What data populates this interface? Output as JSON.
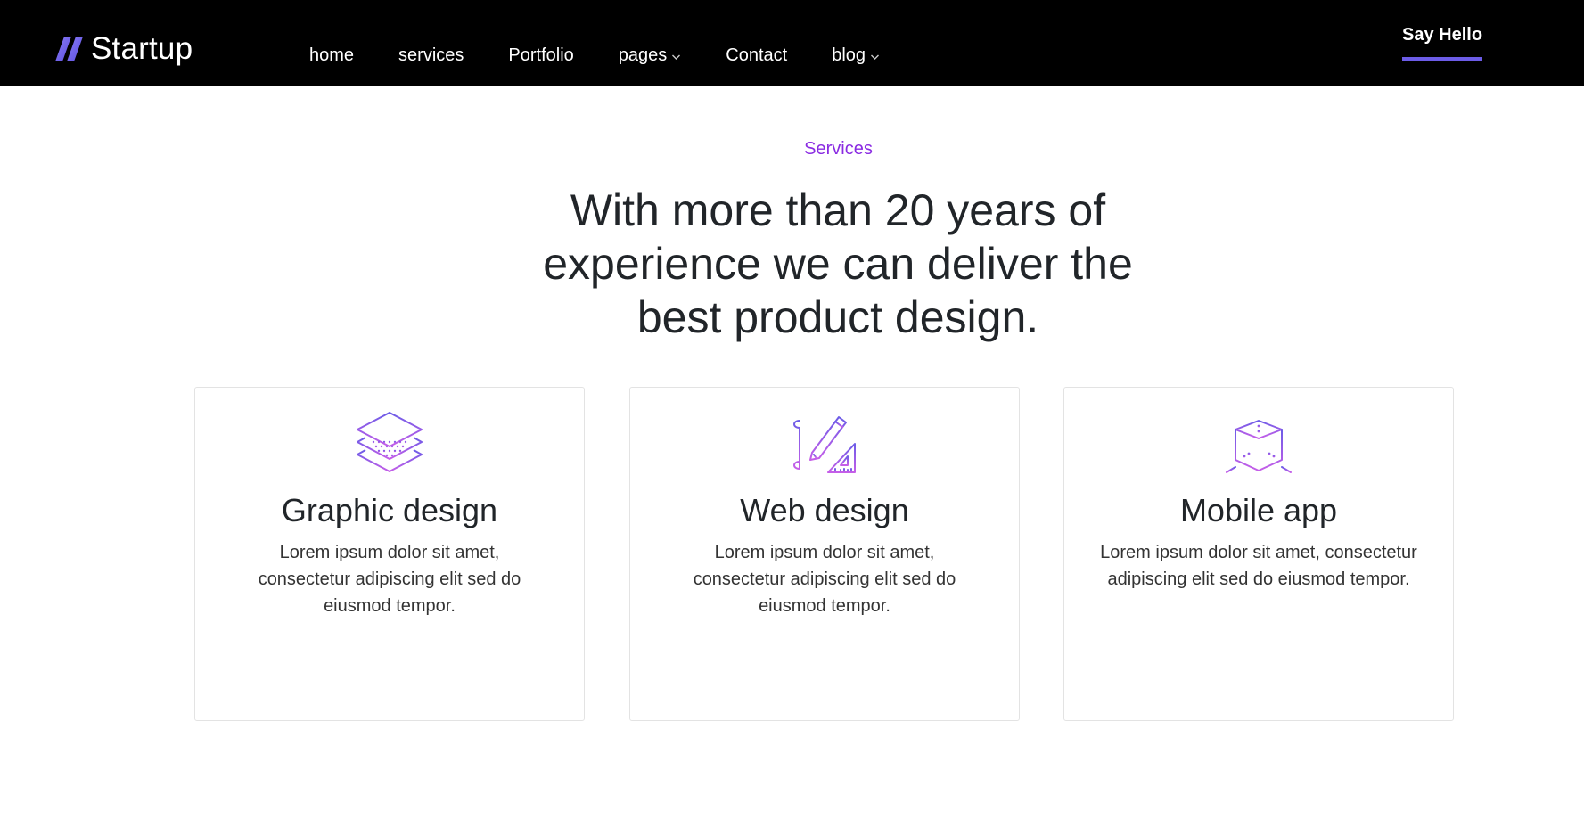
{
  "header": {
    "logo_text": "Startup",
    "nav": [
      {
        "label": "home",
        "dropdown": false
      },
      {
        "label": "services",
        "dropdown": false
      },
      {
        "label": "Portfolio",
        "dropdown": false
      },
      {
        "label": "pages",
        "dropdown": true
      },
      {
        "label": "Contact",
        "dropdown": false
      },
      {
        "label": "blog",
        "dropdown": true
      }
    ],
    "cta_label": "Say Hello"
  },
  "section": {
    "eyebrow": "Services",
    "title": "With more than 20 years of experience we can deliver the best product design."
  },
  "cards": [
    {
      "icon": "layers-icon",
      "title": "Graphic design",
      "text": "Lorem ipsum dolor sit amet, consectetur adipiscing elit sed do eiusmod tempor."
    },
    {
      "icon": "pencil-ruler-icon",
      "title": "Web design",
      "text": "Lorem ipsum dolor sit amet, consectetur adipiscing elit sed do eiusmod tempor."
    },
    {
      "icon": "cube-icon",
      "title": "Mobile app",
      "text": "Lorem ipsum dolor sit amet, consectetur adipiscing elit sed do eiusmod tempor."
    }
  ],
  "colors": {
    "header_bg": "#000000",
    "accent": "#6c5ce7",
    "eyebrow": "#8a2be2",
    "icon_gradient_start": "#6c5ce7",
    "icon_gradient_end": "#c65ee8"
  }
}
